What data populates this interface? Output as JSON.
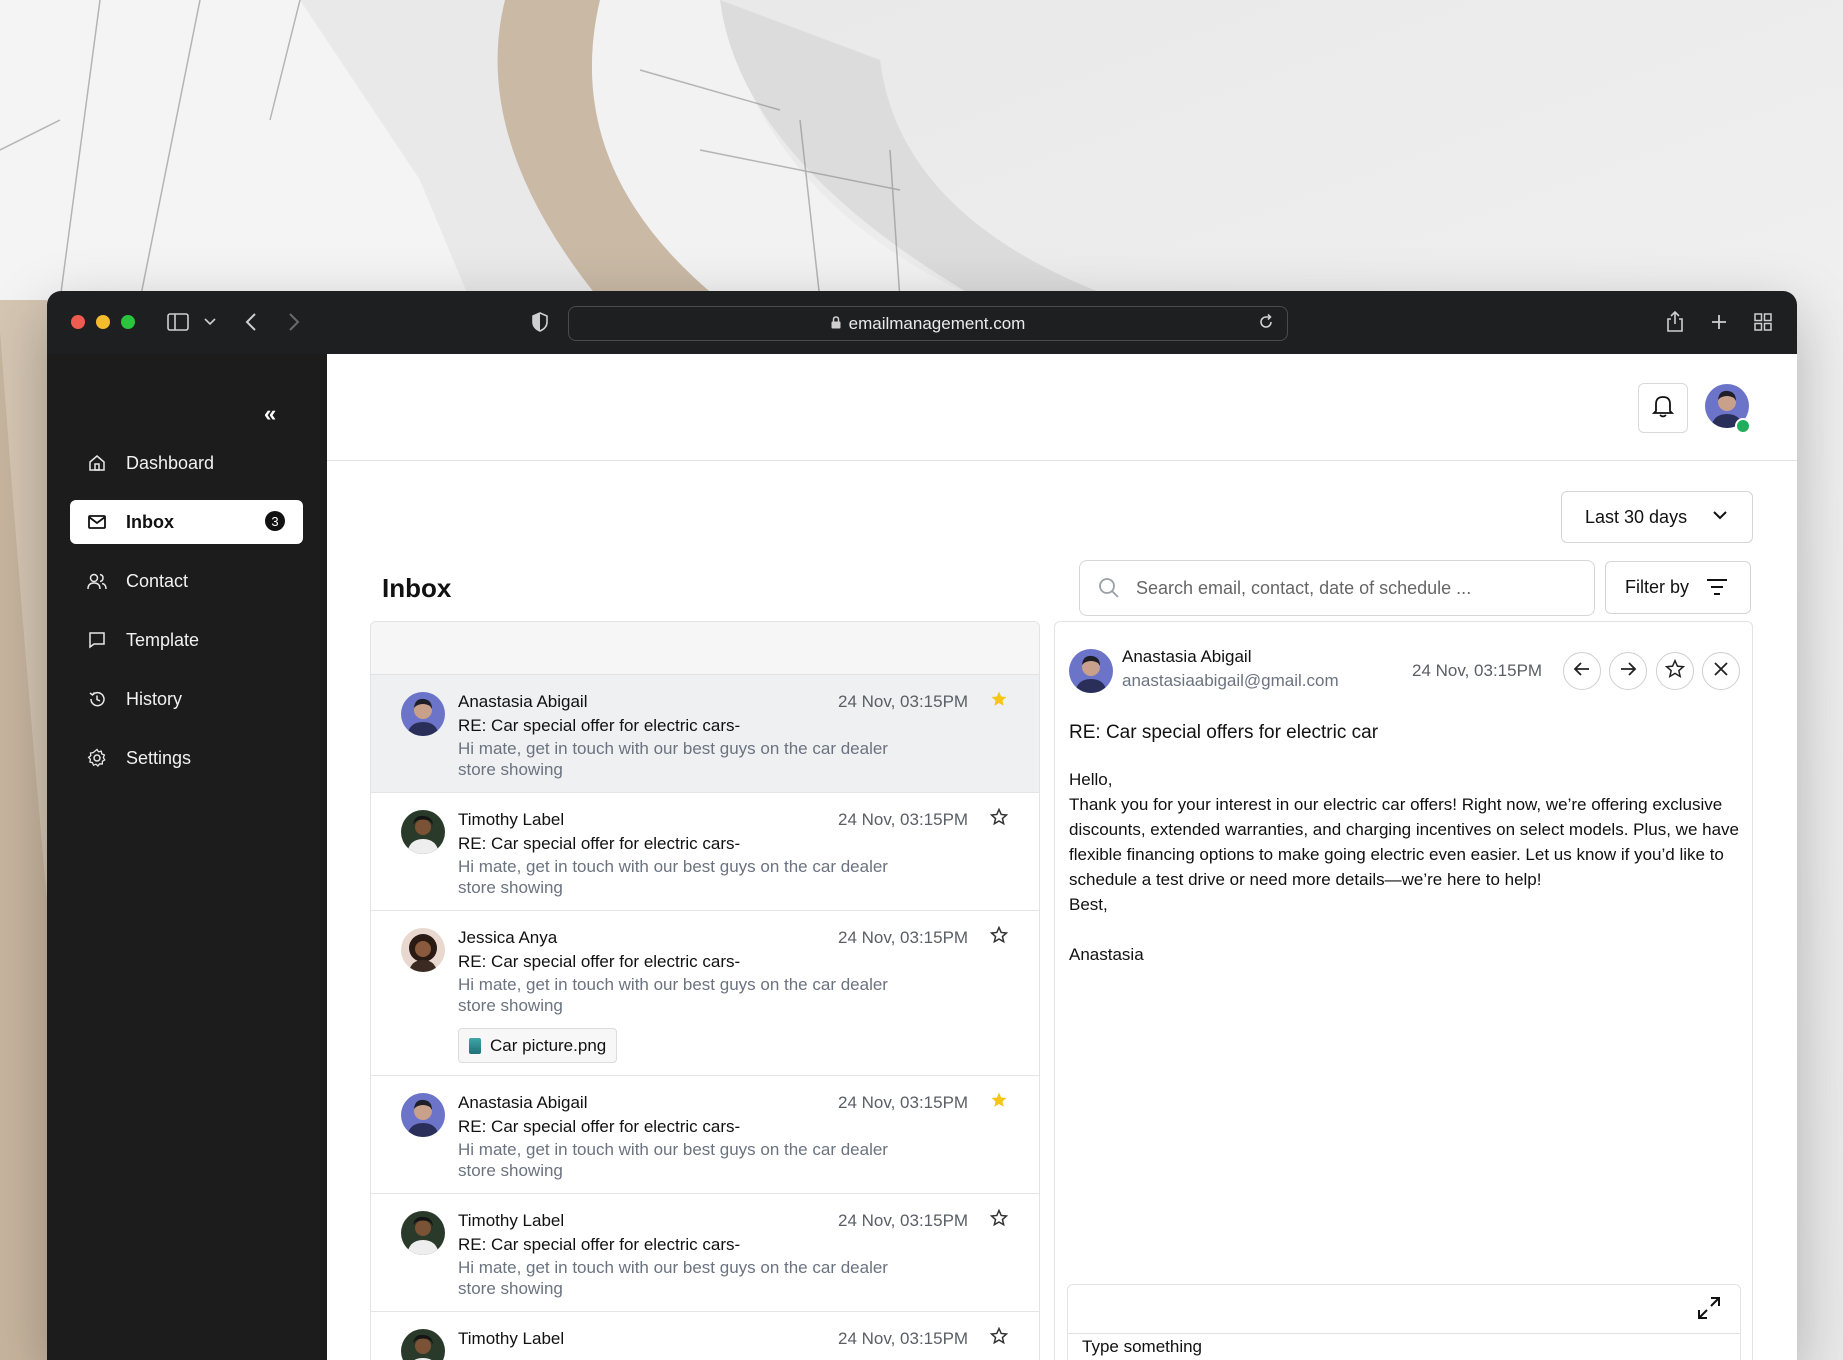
{
  "browser": {
    "url": "emailmanagement.com"
  },
  "sidebar": {
    "collapse_glyph": "«",
    "items": [
      {
        "label": "Dashboard",
        "icon": "home-icon"
      },
      {
        "label": "Inbox",
        "icon": "mail-icon",
        "badge": "3",
        "active": true
      },
      {
        "label": "Contact",
        "icon": "users-icon"
      },
      {
        "label": "Template",
        "icon": "chat-bubble-icon"
      },
      {
        "label": "History",
        "icon": "history-icon"
      },
      {
        "label": "Settings",
        "icon": "gear-icon"
      }
    ]
  },
  "header": {
    "date_range": "Last 30 days",
    "page_title": "Inbox",
    "search_placeholder": "Search email, contact, date of schedule ...",
    "filter_label": "Filter by"
  },
  "emails": [
    {
      "sender": "Anastasia Abigail",
      "date": "24 Nov, 03:15PM",
      "subject": "RE: Car special offer for electric cars-",
      "preview": "Hi mate, get in touch with our best guys on the car dealer store showing",
      "starred": true,
      "selected": true
    },
    {
      "sender": "Timothy Label",
      "date": "24 Nov, 03:15PM",
      "subject": "RE: Car special offer for electric cars-",
      "preview": "Hi mate, get in touch with our best guys on the car dealer store showing",
      "starred": false
    },
    {
      "sender": "Jessica Anya",
      "date": "24 Nov, 03:15PM",
      "subject": "RE: Car special offer for electric cars-",
      "preview": "Hi mate, get in touch with our best guys on the car dealer store showing",
      "starred": false,
      "attachment": "Car picture.png"
    },
    {
      "sender": "Anastasia Abigail",
      "date": "24 Nov, 03:15PM",
      "subject": "RE: Car special offer for electric cars-",
      "preview": "Hi mate, get in touch with our best guys on the car dealer store showing",
      "starred": true
    },
    {
      "sender": "Timothy Label",
      "date": "24 Nov, 03:15PM",
      "subject": "RE: Car special offer for electric cars-",
      "preview": "Hi mate, get in touch with our best guys on the car dealer store showing",
      "starred": false
    },
    {
      "sender": "Timothy Label",
      "date": "24 Nov, 03:15PM",
      "subject": "",
      "preview": "",
      "starred": false
    }
  ],
  "reader": {
    "from_name": "Anastasia Abigail",
    "from_email": "anastasiaabigail@gmail.com",
    "date": "24 Nov, 03:15PM",
    "subject": "RE: Car special offers for electric car",
    "greeting": "Hello,",
    "paragraph": "Thank you for your interest in our electric car offers! Right now, we’re offering exclusive discounts, extended warranties, and charging incentives on select models. Plus, we have flexible financing options to make going electric even easier. Let us know if you’d like to schedule a test drive or need more details—we’re here to help!",
    "signoff": "Best,",
    "signature": "Anastasia",
    "composer_placeholder": "Type something"
  },
  "colors": {
    "star_active": "#f5c518",
    "online": "#1fae5b",
    "sidebar_bg": "#1c1c1d"
  }
}
